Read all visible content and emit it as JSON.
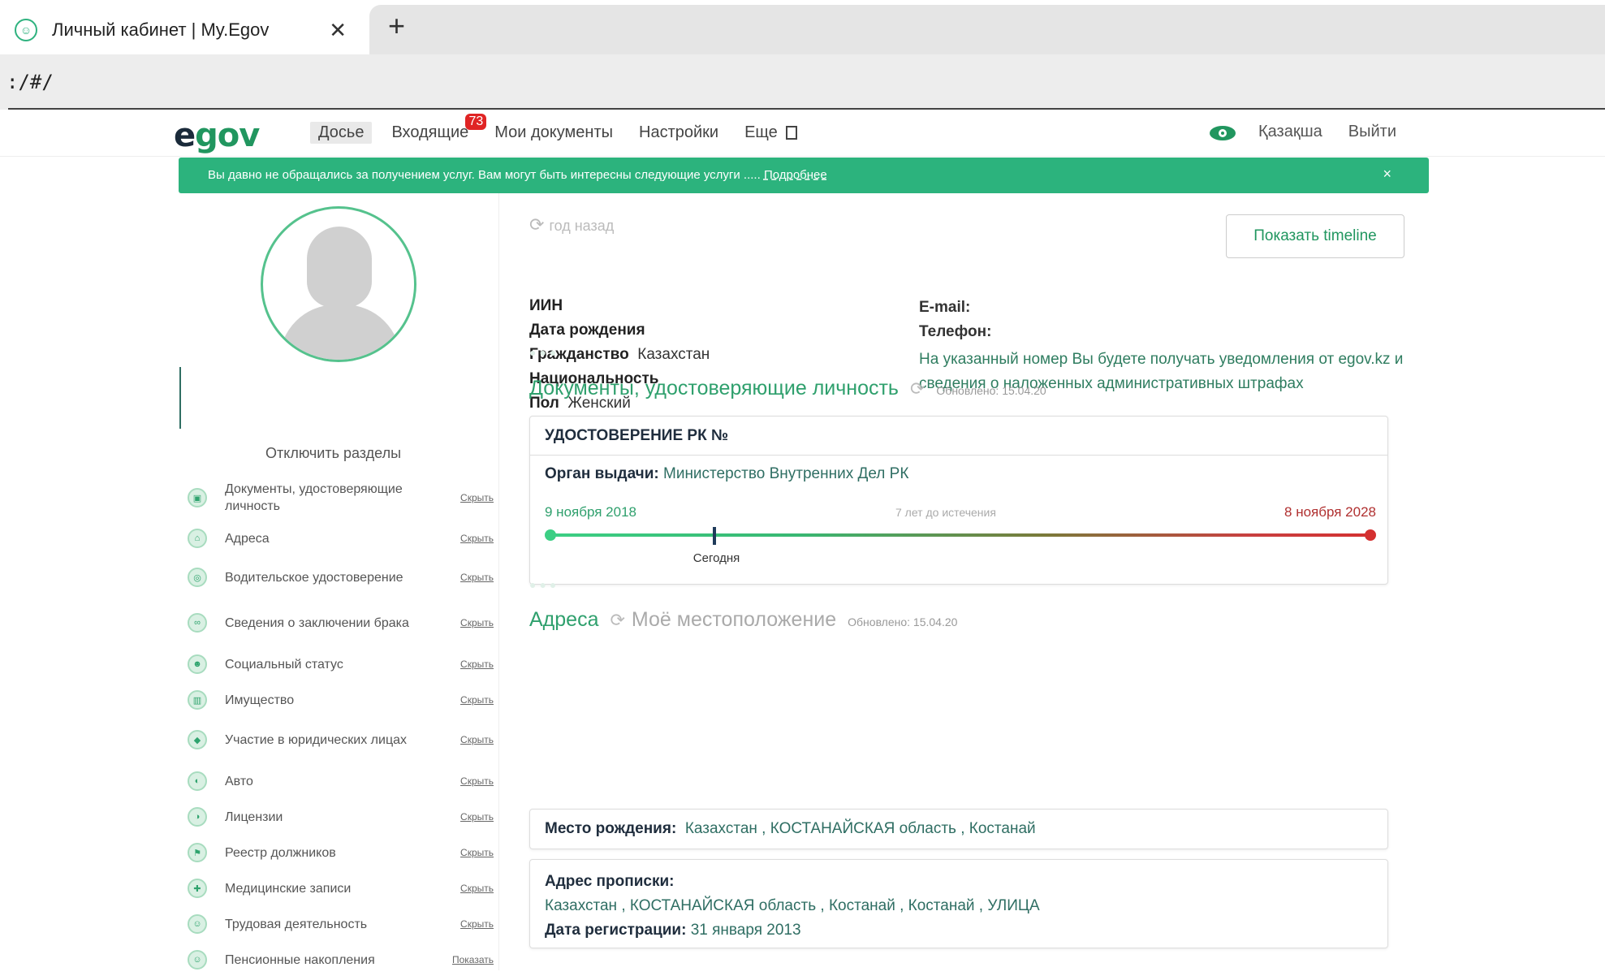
{
  "browser": {
    "tab_title": "Личный кабинет | My.Egov",
    "close_symbol": "✕",
    "new_tab_symbol": "+",
    "url": ":/#/"
  },
  "header": {
    "logo_e": "e",
    "logo_rest": "gov",
    "nav": [
      {
        "label": "Досье"
      },
      {
        "label": "Входящие",
        "badge": "73"
      },
      {
        "label": "Мои документы"
      },
      {
        "label": "Настройки"
      },
      {
        "label": "Еще"
      }
    ],
    "lang": "Қазақша",
    "logout": "Выйти"
  },
  "banner": {
    "text": "Вы давно не обращались за получением услуг. Вам могут быть интересны следующие услуги ..... ",
    "more": "Подробнее",
    "close": "×"
  },
  "sidebar": {
    "disable_sections": "Отключить разделы",
    "sections": [
      {
        "label": "Документы, удостоверяющие личность",
        "action": "Скрыть",
        "icon": "id-card-icon"
      },
      {
        "label": "Адреса",
        "action": "Скрыть",
        "icon": "home-icon"
      },
      {
        "label": "Водительское удостоверение",
        "action": "Скрыть",
        "icon": "steering-wheel-icon"
      },
      {
        "label": "Сведения о заключении брака",
        "action": "Скрыть",
        "icon": "couple-icon"
      },
      {
        "label": "Социальный статус",
        "action": "Скрыть",
        "icon": "people-icon"
      },
      {
        "label": "Имущество",
        "action": "Скрыть",
        "icon": "building-icon"
      },
      {
        "label": "Участие в юридических лицах",
        "action": "Скрыть",
        "icon": "briefcase-icon"
      },
      {
        "label": "Авто",
        "action": "Скрыть",
        "icon": "car-icon"
      },
      {
        "label": "Лицензии",
        "action": "Скрыть",
        "icon": "license-icon"
      },
      {
        "label": "Реестр должников",
        "action": "Скрыть",
        "icon": "flag-icon"
      },
      {
        "label": "Медицинские записи",
        "action": "Скрыть",
        "icon": "medical-icon"
      },
      {
        "label": "Трудовая деятельность",
        "action": "Скрыть",
        "icon": "work-icon"
      },
      {
        "label": "Пенсионные накопления",
        "action": "Показать",
        "icon": "pension-icon"
      }
    ]
  },
  "main": {
    "updated_ago": "год назад",
    "timeline_button": "Показать timeline",
    "personal": {
      "iin_label": "ИИН",
      "birth_label": "Дата рождения",
      "citizenship_label": "Гражданство",
      "citizenship_value": "Казахстан",
      "nationality_label": "Национальность",
      "gender_label": "Пол",
      "gender_value": "Женский",
      "email_label": "E-mail:",
      "phone_label": "Телефон:",
      "phone_note": "На указанный номер Вы будете получать уведомления от egov.kz и сведения о наложенных административных штрафах"
    },
    "id_docs": {
      "title": "Документы, удостоверяющие личность",
      "updated": "Обновлено: 15.04.20",
      "card_title": "УДОСТОВЕРЕНИЕ РК №",
      "issuer_label": "Орган выдачи:",
      "issuer_value": "Министерство Внутренних Дел РК",
      "start_date": "9 ноября 2018",
      "remaining": "7 лет до истечения",
      "end_date": "8 ноября 2028",
      "today": "Сегодня",
      "elapsed_fraction": 0.2
    },
    "addresses": {
      "title": "Адреса",
      "location": "Моё местоположение",
      "updated": "Обновлено: 15.04.20",
      "birthplace_label": "Место рождения:",
      "birthplace_value": "Казахстан , КОСТАНАЙСКАЯ область , Костанай",
      "registration_label": "Адрес прописки:",
      "registration_value": "Казахстан , КОСТАНАЙСКАЯ область , Костанай , Костанай , УЛИЦА",
      "reg_date_label": "Дата регистрации:",
      "reg_date_value": "31 января 2013"
    }
  },
  "colors": {
    "brand_green": "#2cb37d",
    "expiry_red": "#d43030"
  }
}
